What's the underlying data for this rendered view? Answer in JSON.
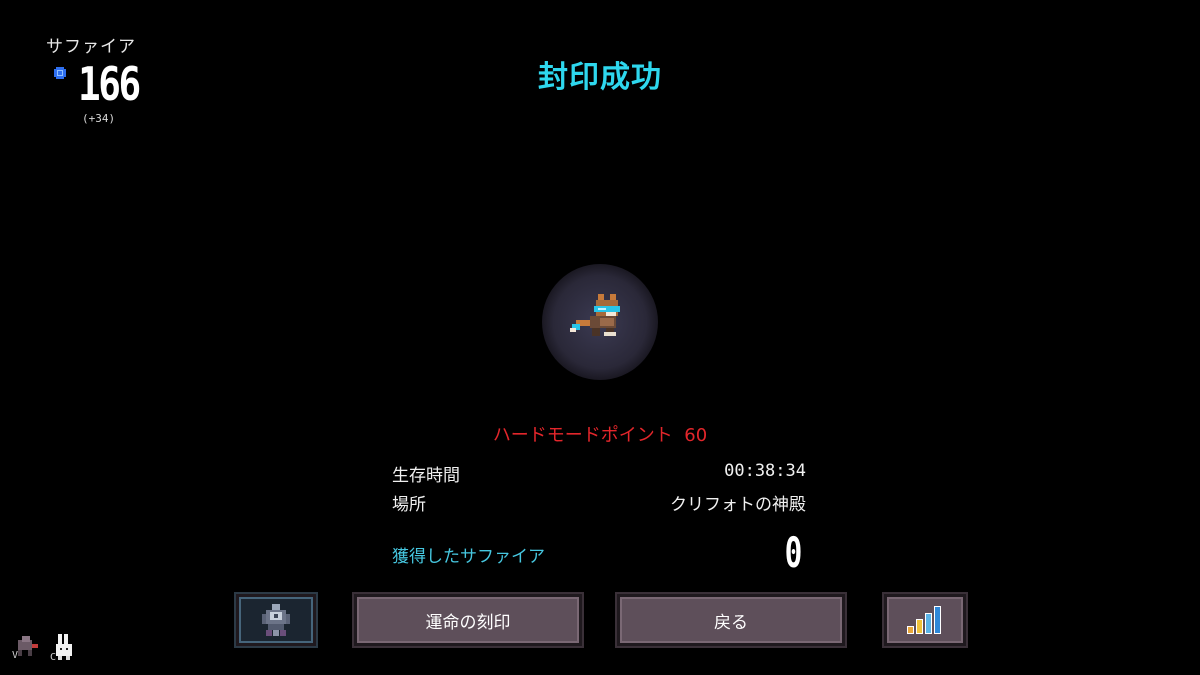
{
  "currency": {
    "label": "サファイア",
    "value": "166",
    "delta": "(+34)",
    "icon": "sapphire-gem-icon"
  },
  "title": "封印成功",
  "portrait": {
    "icon": "fox-character-icon"
  },
  "stats": {
    "hard_mode": "ハードモードポイント  60",
    "survival_label": "生存時間",
    "survival_value": "00:38:34",
    "location_label": "場所",
    "location_value": "クリフォトの神殿",
    "sapphire_label": "獲得したサファイア",
    "sapphire_value": "0"
  },
  "buttons": {
    "sigil_icon": "sigil-emblem-icon",
    "fate_label": "運命の刻印",
    "back_label": "戻る",
    "stats_icon": "bar-chart-icon"
  },
  "hotkeys": [
    {
      "key": "V",
      "icon": "pet-icon"
    },
    {
      "key": "C",
      "icon": "rabbit-icon"
    }
  ],
  "colors": {
    "title": "#2ed7ee",
    "hard_mode": "#e3262b",
    "sapphire_label": "#46c7e0",
    "button": "#5e4f5a",
    "portrait_bg": "#2a2838"
  }
}
